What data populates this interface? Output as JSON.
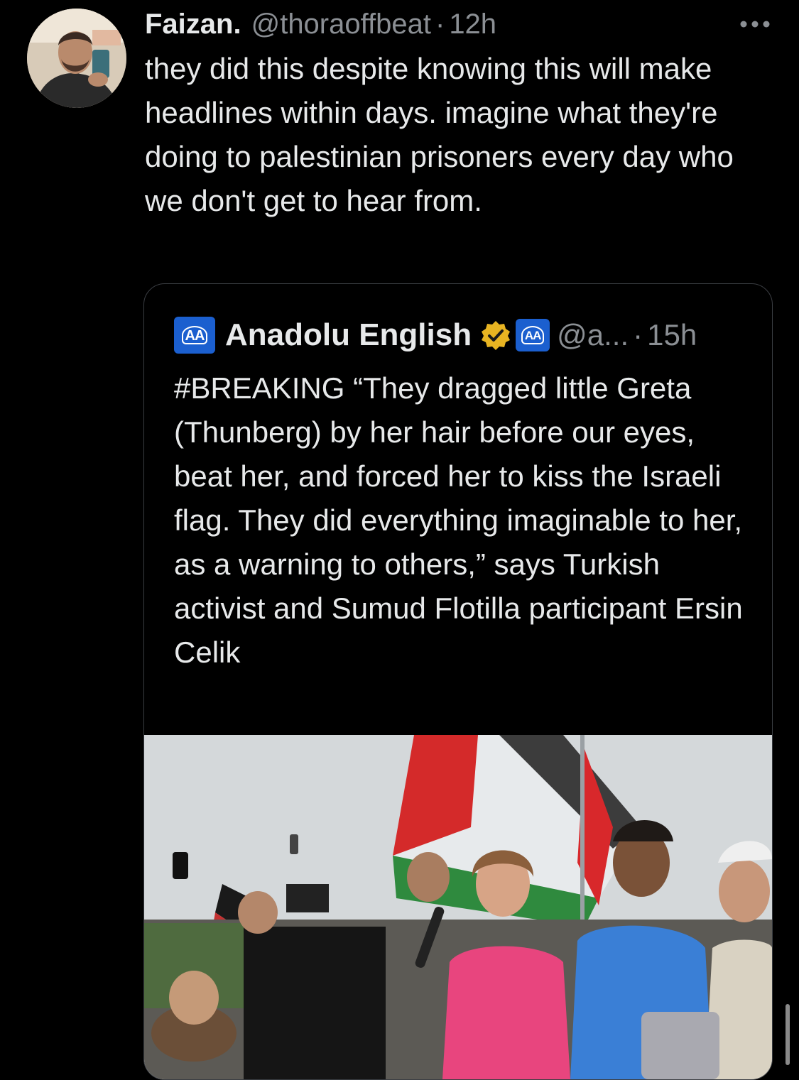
{
  "tweet": {
    "author": {
      "display_name": "Faizan.",
      "handle": "@thoraoffbeat",
      "separator": "·",
      "timestamp": "12h",
      "avatar_icon": "profile-photo"
    },
    "more_icon": "more-dots-icon",
    "text": "they did this despite knowing this will make headlines within days. imagine what they're doing to palestinian prisoners every day who we don't get to hear from."
  },
  "quoted_tweet": {
    "author": {
      "logo_text": "AA",
      "display_name": "Anadolu English",
      "verified_icon": "gold-verified-badge-icon",
      "affiliate_logo_text": "AA",
      "handle": "@a...",
      "separator": "·",
      "timestamp": "15h"
    },
    "text": "#BREAKING “They dragged little Greta (Thunberg) by her hair before our eyes, beat her, and forced her to kiss the Israeli flag. They did everything imaginable to her, as a warning to others,” says Turkish activist and Sumud Flotilla participant Ersin Celik",
    "media": {
      "type": "photo",
      "description_icon": "protest-photo"
    }
  },
  "colors": {
    "background": "#000000",
    "primary_text": "#e7e9ea",
    "secondary_text": "#8b8f94",
    "border": "#3a3d42",
    "aa_blue": "#1b5fcf",
    "verified_gold": "#e8b422"
  }
}
